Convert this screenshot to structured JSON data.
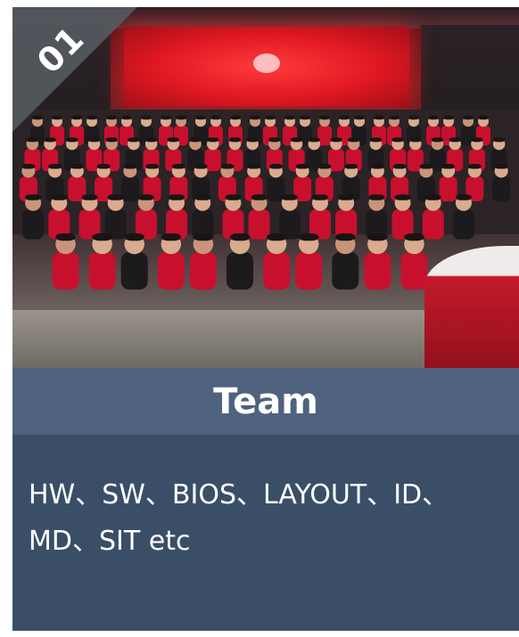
{
  "card": {
    "badge_number": "01",
    "title": "Team",
    "description": "HW、SW、BIOS、LAYOUT、ID、MD、SIT etc"
  },
  "colors": {
    "title_bar": "#4f627e",
    "body": "#3a4e68",
    "badge": "#555a5f",
    "scarf_red": "#c8102e"
  },
  "photo": {
    "icon": "group-photo"
  }
}
